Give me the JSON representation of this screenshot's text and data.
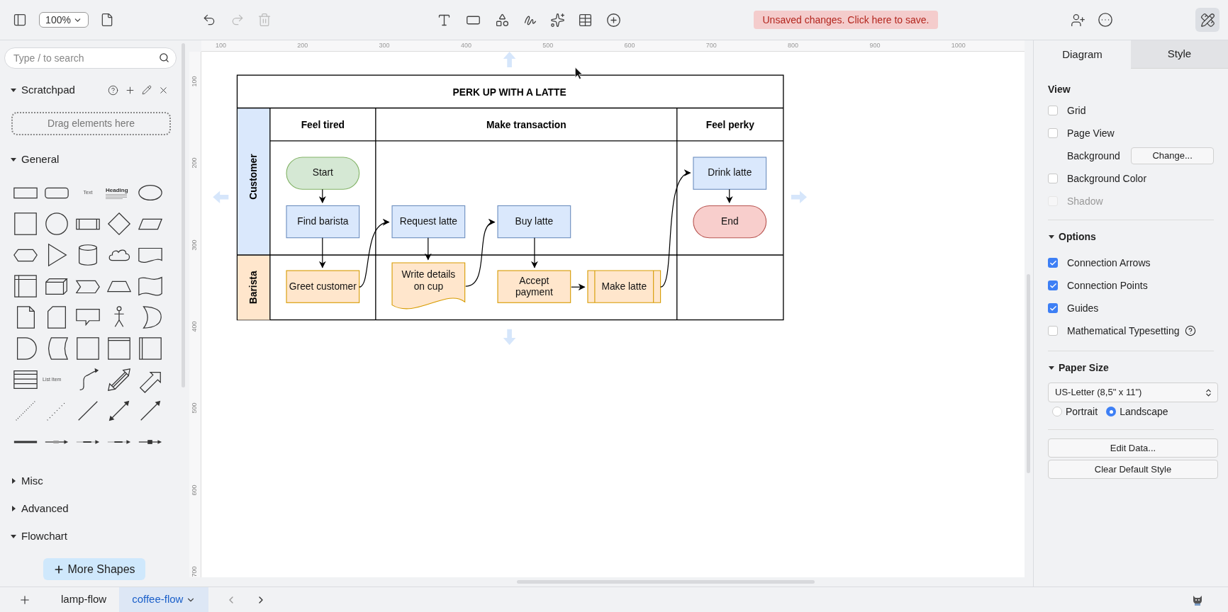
{
  "toolbar": {
    "zoom": "100%",
    "notice": "Unsaved changes. Click here to save.",
    "history": [
      {
        "kind": "undo",
        "disabled": false
      },
      {
        "kind": "redo",
        "disabled": true
      },
      {
        "kind": "delete",
        "disabled": true
      }
    ],
    "format_toggle": {
      "selected": true
    }
  },
  "sidebar": {
    "search": {
      "placeholder": "Type / to search"
    },
    "scratchpad": {
      "title": "Scratchpad",
      "expanded": true,
      "drop_hint": "Drag elements here"
    },
    "sections": [
      {
        "title": "General",
        "expanded": true,
        "shapes": [
          {
            "kind": "rectangle"
          },
          {
            "kind": "rounded-rectangle"
          },
          {
            "kind": "text",
            "label": "Text"
          },
          {
            "kind": "textbox",
            "label": "Heading"
          },
          {
            "kind": "ellipse"
          },
          {
            "kind": "square"
          },
          {
            "kind": "circle"
          },
          {
            "kind": "process"
          },
          {
            "kind": "diamond"
          },
          {
            "kind": "parallelogram"
          },
          {
            "kind": "hexagon"
          },
          {
            "kind": "triangle"
          },
          {
            "kind": "cylinder"
          },
          {
            "kind": "cloud"
          },
          {
            "kind": "document"
          },
          {
            "kind": "internal-storage"
          },
          {
            "kind": "cube"
          },
          {
            "kind": "step"
          },
          {
            "kind": "trapezoid"
          },
          {
            "kind": "tape"
          },
          {
            "kind": "note"
          },
          {
            "kind": "card"
          },
          {
            "kind": "callout"
          },
          {
            "kind": "actor"
          },
          {
            "kind": "crescent"
          },
          {
            "kind": "half-circle"
          },
          {
            "kind": "data-storage"
          },
          {
            "kind": "square"
          },
          {
            "kind": "container"
          },
          {
            "kind": "vertical-container"
          },
          {
            "kind": "list"
          },
          {
            "kind": "list-item",
            "label": "List Item"
          },
          {
            "kind": "curved-arrow"
          },
          {
            "kind": "double-block-arrow"
          },
          {
            "kind": "block-arrow"
          },
          {
            "kind": "dotted-line"
          },
          {
            "kind": "sparse-dotted-line"
          },
          {
            "kind": "line"
          },
          {
            "kind": "bidirectional-arrow"
          },
          {
            "kind": "directional-arrow"
          },
          {
            "kind": "thick-line"
          },
          {
            "kind": "labeled-arrow"
          },
          {
            "kind": "labeled-connector"
          },
          {
            "kind": "labeled-connector"
          },
          {
            "kind": "boxed-connector"
          }
        ]
      },
      {
        "title": "Misc",
        "expanded": false
      },
      {
        "title": "Advanced",
        "expanded": false
      },
      {
        "title": "Flowchart",
        "expanded": true
      }
    ],
    "more_shapes": "More Shapes"
  },
  "rulers": {
    "horizontal": [
      "100",
      "200",
      "300",
      "400",
      "500",
      "600",
      "700",
      "800",
      "900",
      "1000"
    ],
    "vertical": [
      "100",
      "200",
      "300",
      "400",
      "500",
      "600",
      "700"
    ]
  },
  "diagram": {
    "title": "PERK UP WITH A LATTE",
    "phases": [
      "Feel tired",
      "Make transaction",
      "Feel perky"
    ],
    "lanes": [
      {
        "label": "Customer",
        "color": "#dae8fc"
      },
      {
        "label": "Barista",
        "color": "#ffe6cc"
      }
    ],
    "nodes": [
      {
        "kind": "terminator",
        "label": "Start",
        "color": "#d5e8d4"
      },
      {
        "kind": "process",
        "label": "Find barista",
        "color": "#dae8fc"
      },
      {
        "kind": "process",
        "label": "Greet customer",
        "color": "#ffe6cc"
      },
      {
        "kind": "process",
        "label": "Request latte",
        "color": "#dae8fc"
      },
      {
        "kind": "document",
        "label": "Write details on cup",
        "color": "#ffe6cc"
      },
      {
        "kind": "process",
        "label": "Buy latte",
        "color": "#dae8fc"
      },
      {
        "kind": "process",
        "label": "Accept payment",
        "color": "#ffe6cc"
      },
      {
        "kind": "subprocess",
        "label": "Make latte",
        "color": "#ffe6cc"
      },
      {
        "kind": "process",
        "label": "Drink latte",
        "color": "#dae8fc"
      },
      {
        "kind": "terminator",
        "label": "End",
        "color": "#f8cecc"
      }
    ]
  },
  "format_panel": {
    "tabs": [
      {
        "label": "Diagram",
        "selected": true
      },
      {
        "label": "Style",
        "selected": false
      }
    ],
    "sections": [
      {
        "title": "View",
        "rows": [
          {
            "kind": "checkbox",
            "label": "Grid",
            "checked": false,
            "disabled": false
          },
          {
            "kind": "checkbox",
            "label": "Page View",
            "checked": false,
            "disabled": false
          },
          {
            "kind": "button",
            "label": "Background",
            "button": "Change..."
          },
          {
            "kind": "checkbox",
            "label": "Background Color",
            "checked": false,
            "disabled": false
          },
          {
            "kind": "checkbox",
            "label": "Shadow",
            "checked": false,
            "disabled": true
          }
        ]
      },
      {
        "title": "Options",
        "expanded": true,
        "rows": [
          {
            "kind": "checkbox",
            "label": "Connection Arrows",
            "checked": true,
            "disabled": false
          },
          {
            "kind": "checkbox",
            "label": "Connection Points",
            "checked": true,
            "disabled": false
          },
          {
            "kind": "checkbox",
            "label": "Guides",
            "checked": true,
            "disabled": false
          },
          {
            "kind": "checkbox",
            "label": "Mathematical Typesetting",
            "checked": false,
            "disabled": false,
            "help": true
          }
        ]
      },
      {
        "title": "Paper Size",
        "expanded": true,
        "rows": [
          {
            "kind": "select",
            "value": "US-Letter (8,5\" x 11\")"
          },
          {
            "kind": "radios",
            "options": [
              {
                "label": "Portrait",
                "selected": false
              },
              {
                "label": "Landscape",
                "selected": true
              }
            ]
          }
        ]
      },
      {
        "rows": [
          {
            "kind": "wide-button",
            "label": "Edit Data..."
          },
          {
            "kind": "wide-button",
            "label": "Clear Default Style"
          }
        ]
      }
    ]
  },
  "page_tabs": [
    {
      "label": "lamp-flow",
      "selected": false
    },
    {
      "label": "coffee-flow",
      "selected": true
    }
  ]
}
